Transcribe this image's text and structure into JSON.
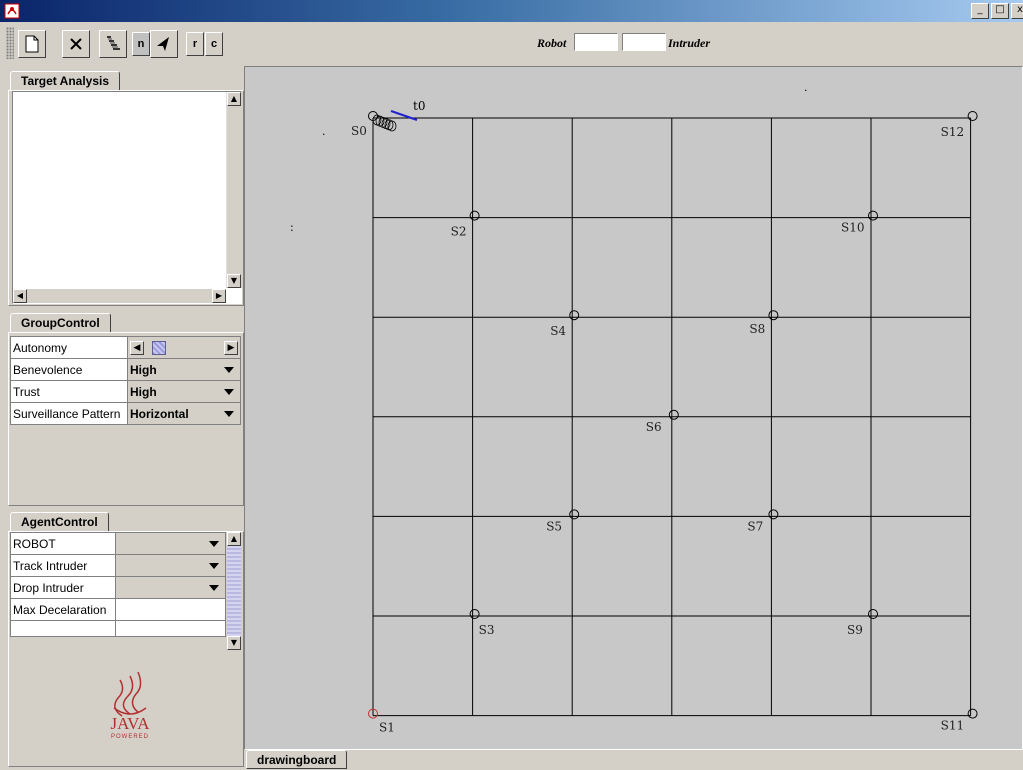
{
  "window": {
    "icon": "java-app-icon",
    "buttons": [
      "_",
      "□",
      "x"
    ]
  },
  "toolbar": {
    "buttons": [
      {
        "name": "new-document-button",
        "icon": "document-icon"
      },
      {
        "name": "close-button",
        "icon": "x-icon"
      },
      {
        "name": "stairs-button",
        "icon": "stairs-icon"
      },
      {
        "name": "n-button",
        "label": "n"
      },
      {
        "name": "arrow-tool-button",
        "icon": "arrowhead-icon"
      },
      {
        "name": "r-button",
        "label": "r"
      },
      {
        "name": "c-button",
        "label": "c"
      }
    ],
    "robot_label": "Robot",
    "robot_value": "",
    "intruder_value": "",
    "intruder_label": "Intruder"
  },
  "target_analysis": {
    "tab": "Target Analysis",
    "text": ""
  },
  "group_control": {
    "tab": "GroupControl",
    "rows": [
      {
        "label": "Autonomy",
        "type": "slider",
        "value": 0.1
      },
      {
        "label": "Benevolence",
        "type": "combo",
        "value": "High"
      },
      {
        "label": "Trust",
        "type": "combo",
        "value": "High"
      },
      {
        "label": "Surveillance Pattern",
        "type": "combo",
        "value": "Horizontal"
      }
    ]
  },
  "agent_control": {
    "tab": "AgentControl",
    "rows": [
      {
        "label": "ROBOT",
        "value": ""
      },
      {
        "label": "Track Intruder",
        "value": ""
      },
      {
        "label": "Drop Intruder",
        "value": ""
      },
      {
        "label": "Max Decelaration",
        "value": ""
      },
      {
        "label": "",
        "value": ""
      }
    ]
  },
  "logo": {
    "text": "JAVA",
    "subtext": "POWERED"
  },
  "drawing_board": {
    "tab": "drawingboard",
    "grid": {
      "cols": 6,
      "rows": 6
    },
    "time_label": "t0",
    "stray_marks": [
      ":",
      "."
    ],
    "stations": [
      {
        "id": "S0",
        "col": 0,
        "row": 0
      },
      {
        "id": "S12",
        "col": 6,
        "row": 0
      },
      {
        "id": "S2",
        "col": 1,
        "row": 1
      },
      {
        "id": "S10",
        "col": 5,
        "row": 1
      },
      {
        "id": "S4",
        "col": 2,
        "row": 2
      },
      {
        "id": "S8",
        "col": 4,
        "row": 2
      },
      {
        "id": "S6",
        "col": 3,
        "row": 3
      },
      {
        "id": "S5",
        "col": 2,
        "row": 4
      },
      {
        "id": "S7",
        "col": 4,
        "row": 4
      },
      {
        "id": "S3",
        "col": 1,
        "row": 5
      },
      {
        "id": "S9",
        "col": 5,
        "row": 5
      },
      {
        "id": "S1",
        "col": 0,
        "row": 6
      },
      {
        "id": "S11",
        "col": 6,
        "row": 6
      }
    ]
  }
}
